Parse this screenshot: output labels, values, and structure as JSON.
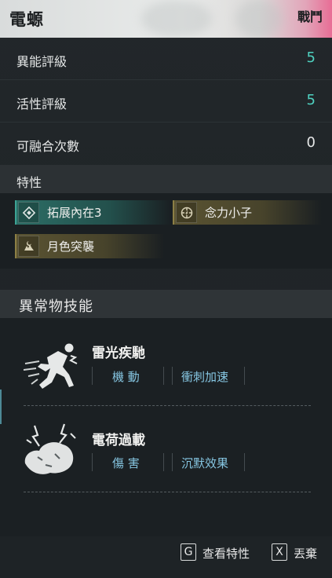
{
  "header": {
    "title": "電螈",
    "badge": "戰鬥"
  },
  "stats": [
    {
      "label": "異能評級",
      "value": "5"
    },
    {
      "label": "活性評級",
      "value": "5"
    },
    {
      "label": "可融合次數",
      "value": "0"
    }
  ],
  "traits": {
    "heading": "特性",
    "items": [
      {
        "label": "拓展內在3",
        "icon": "diamond-icon"
      },
      {
        "label": "念力小子",
        "icon": "target-icon"
      },
      {
        "label": "月色突襲",
        "icon": "moon-strike-icon"
      }
    ]
  },
  "skills": {
    "heading": "異常物技能",
    "items": [
      {
        "name": "雷光疾馳",
        "tags": [
          "機 動",
          "衝刺加速"
        ],
        "icon": "running-lightning-icon"
      },
      {
        "name": "電荷過載",
        "tags": [
          "傷 害",
          "沉默效果"
        ],
        "icon": "charged-creature-icon"
      }
    ]
  },
  "footer": {
    "actions": [
      {
        "key": "G",
        "label": "查看特性"
      },
      {
        "key": "X",
        "label": "丟棄"
      }
    ]
  },
  "colors": {
    "accent_teal": "#4fd1c0",
    "tag_blue": "#86c6e2",
    "header_pink": "#e86d95"
  }
}
